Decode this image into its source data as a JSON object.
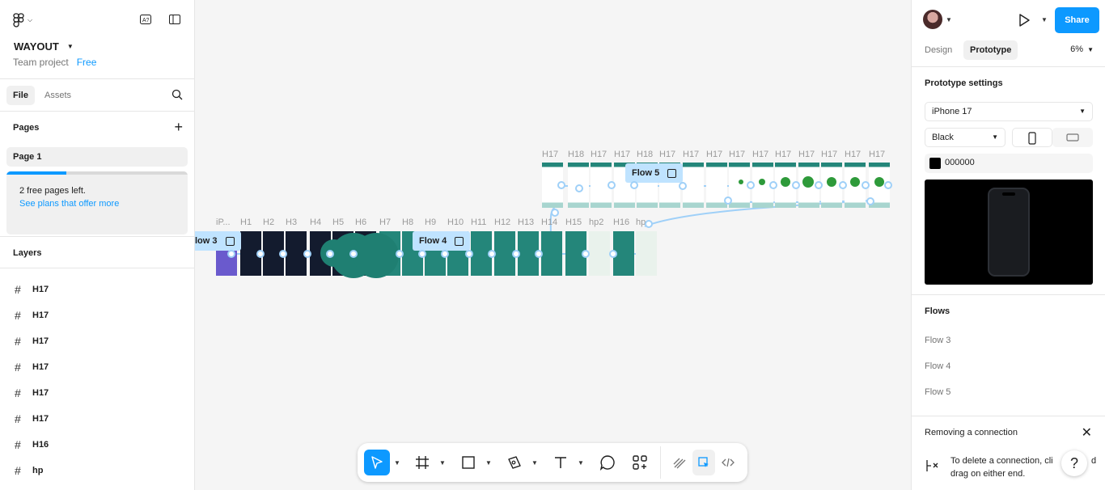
{
  "left_panel": {
    "project_name": "WAYOUT",
    "project_type": "Team project",
    "plan_badge": "Free",
    "tabs": {
      "file": "File",
      "assets": "Assets"
    },
    "pages_title": "Pages",
    "current_page": "Page 1",
    "pages_progress": 0.33,
    "banner_text": "2 free pages left.",
    "banner_link": "See plans that offer more",
    "layers_title": "Layers",
    "layers": [
      "H17",
      "H17",
      "H17",
      "H17",
      "H17",
      "H17",
      "H16",
      "hp"
    ]
  },
  "canvas": {
    "row1_labels": [
      "iP...",
      "H1",
      "H2",
      "H3",
      "H4",
      "H5",
      "H6",
      "H7",
      "H8",
      "H9",
      "H10",
      "H11",
      "H12",
      "H13",
      "H14",
      "H15",
      "hp2",
      "H16",
      "hp"
    ],
    "row2_labels": [
      "H17",
      "H18",
      "H17",
      "H17",
      "H18",
      "H17",
      "H17",
      "H17",
      "H17",
      "H17",
      "H17",
      "H17",
      "H17",
      "H17",
      "H17"
    ],
    "flow_tags": [
      "low 3",
      "Flow 4",
      "Flow 5"
    ]
  },
  "toolbar": {
    "tools": [
      "move-tool",
      "frame-tool",
      "shape-tool",
      "pen-tool",
      "text-tool",
      "comment-tool",
      "actions-tool",
      "draw-mode",
      "design-mode",
      "dev-mode"
    ]
  },
  "right_panel": {
    "share_label": "Share",
    "tabs": {
      "design": "Design",
      "prototype": "Prototype"
    },
    "zoom": "6%",
    "settings_title": "Prototype settings",
    "device": "iPhone 17",
    "color_model": "Black",
    "background_hex": "000000",
    "flows_title": "Flows",
    "flows": [
      "Flow 3",
      "Flow 4",
      "Flow 5"
    ],
    "tip_title": "Removing a connection",
    "tip_text_1": "To delete a connection, cli",
    "tip_text_1b": "d",
    "tip_text_2": "drag on either end.",
    "help": "?"
  },
  "colors": {
    "accent": "#0d99ff",
    "teal": "#24867a",
    "navy": "#131b2e",
    "flow_tag": "#bfe3ff"
  }
}
